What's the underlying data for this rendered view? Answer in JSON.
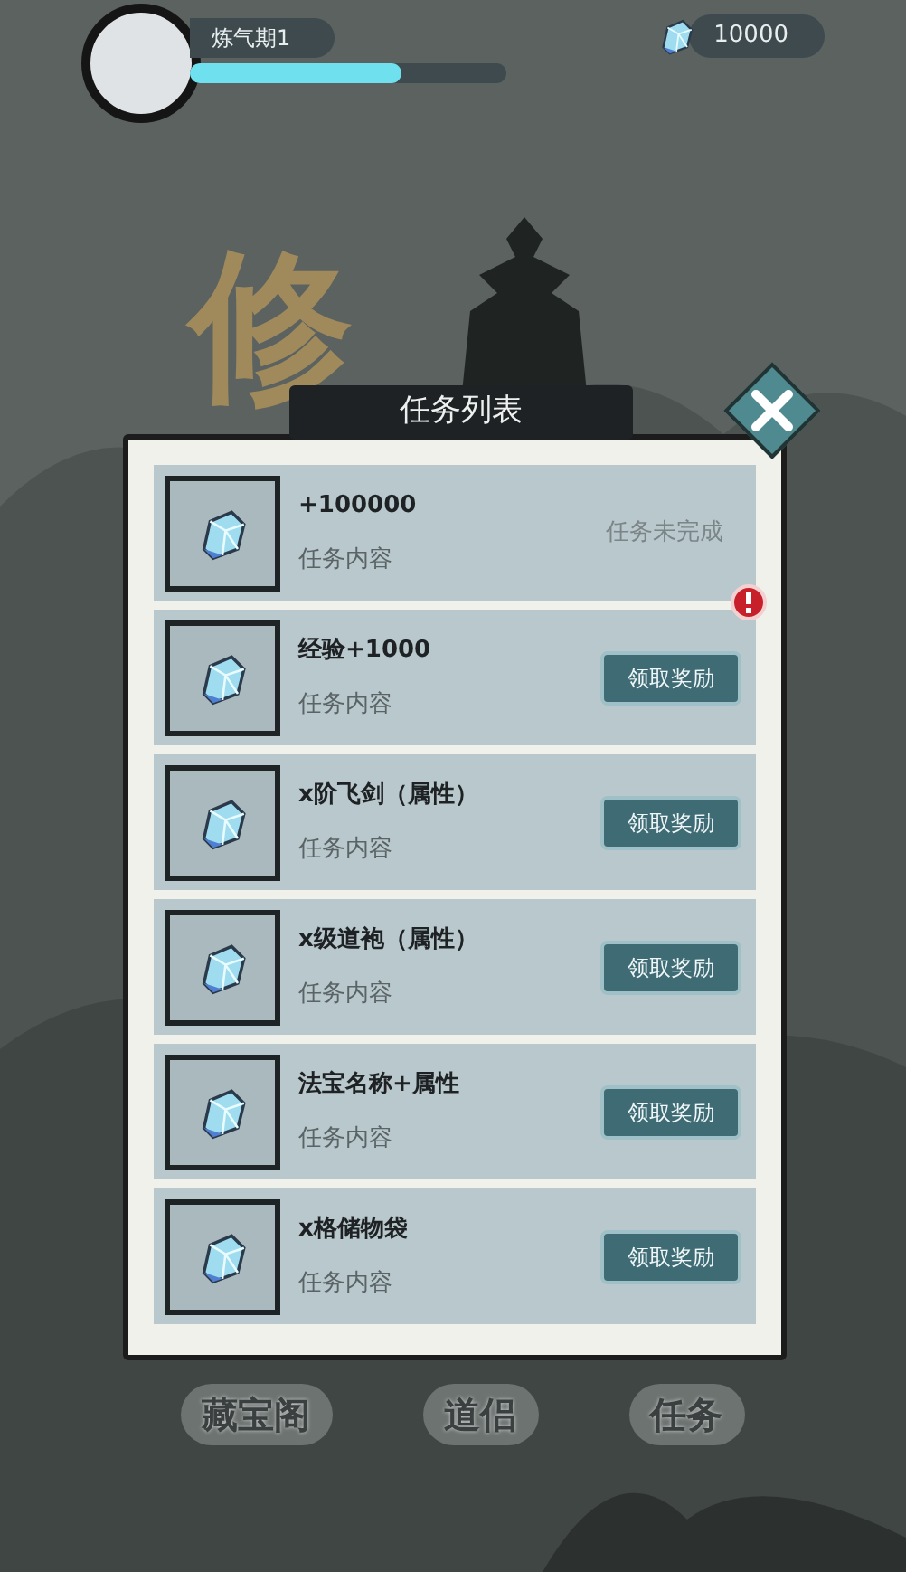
{
  "player": {
    "realm": "炼气期1",
    "level": 0.67
  },
  "currency": {
    "amount": "10000"
  },
  "game_title": "修",
  "dialog": {
    "title": "任务列表",
    "tasks": [
      {
        "reward": "+100000",
        "description": "任务内容",
        "kind": "status",
        "status": "任务未完成",
        "alert": false
      },
      {
        "reward": "经验+1000",
        "description": "任务内容",
        "kind": "claim",
        "button": "领取奖励",
        "alert": true
      },
      {
        "reward": "x阶飞剑（属性）",
        "description": "任务内容",
        "kind": "claim",
        "button": "领取奖励",
        "alert": false
      },
      {
        "reward": "x级道袍（属性）",
        "description": "任务内容",
        "kind": "claim",
        "button": "领取奖励",
        "alert": false
      },
      {
        "reward": "法宝名称+属性",
        "description": "任务内容",
        "kind": "claim",
        "button": "领取奖励",
        "alert": false
      },
      {
        "reward": "x格储物袋",
        "description": "任务内容",
        "kind": "claim",
        "button": "领取奖励",
        "alert": false
      }
    ]
  },
  "bottom_nav": [
    {
      "label": "藏宝阁"
    },
    {
      "label": "道侣"
    },
    {
      "label": "任务"
    }
  ]
}
